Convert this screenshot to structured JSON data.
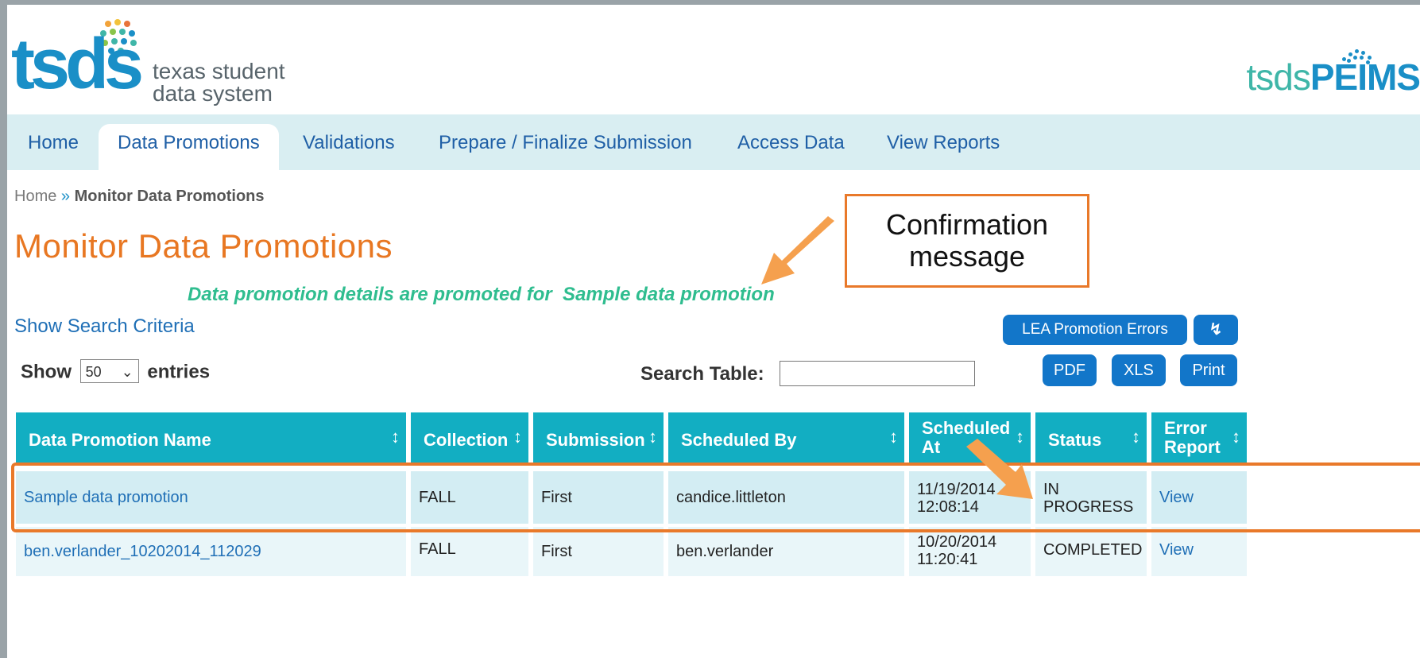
{
  "header": {
    "logo_text": "tsds",
    "logo_subtitle_line1": "texas student",
    "logo_subtitle_line2": "data system",
    "brand_prefix": "tsds",
    "brand_name": "PEIMS"
  },
  "nav": {
    "items": [
      {
        "label": "Home"
      },
      {
        "label": "Data Promotions"
      },
      {
        "label": "Validations"
      },
      {
        "label": "Prepare / Finalize Submission"
      },
      {
        "label": "Access Data"
      },
      {
        "label": "View Reports"
      }
    ],
    "active": "Data Promotions"
  },
  "breadcrumb": {
    "home": "Home",
    "separator": "»",
    "current": "Monitor Data Promotions"
  },
  "page_title": "Monitor Data Promotions",
  "confirmation_message": "Data promotion details are promoted for  Sample data promotion",
  "show_search_criteria": "Show Search Criteria",
  "callout": {
    "line1": "Confirmation",
    "line2": "message"
  },
  "toolbar": {
    "lea_errors": "LEA Promotion Errors",
    "refresh_icon": "refresh-icon",
    "pdf": "PDF",
    "xls": "XLS",
    "print": "Print"
  },
  "entries": {
    "show": "Show",
    "value": "50",
    "suffix": "entries"
  },
  "search": {
    "label": "Search Table:",
    "value": ""
  },
  "table": {
    "headers": {
      "name": "Data Promotion Name",
      "collection": "Collection",
      "submission": "Submission",
      "scheduled_by": "Scheduled By",
      "scheduled_at_1": "Scheduled",
      "scheduled_at_2": "At",
      "status": "Status",
      "error_report_1": "Error",
      "error_report_2": "Report"
    },
    "rows": [
      {
        "name": "Sample data promotion",
        "collection": "FALL",
        "submission": "First",
        "scheduled_by": "candice.littleton",
        "date": "11/19/2014",
        "time": "12:08:14",
        "status_1": "IN",
        "status_2": "PROGRESS",
        "error_report": "View"
      },
      {
        "name": "ben.verlander_10202014_112029",
        "collection": "FALL",
        "submission": "First",
        "scheduled_by": "ben.verlander",
        "date": "10/20/2014",
        "time": "11:20:41",
        "status_1": "COMPLETED",
        "status_2": "",
        "error_report": "View"
      }
    ]
  },
  "colors": {
    "accent_orange": "#e87722",
    "header_teal": "#12aec2",
    "button_blue": "#1276c9",
    "link_blue": "#1f6fb6",
    "confirm_green": "#2fbd8f"
  }
}
